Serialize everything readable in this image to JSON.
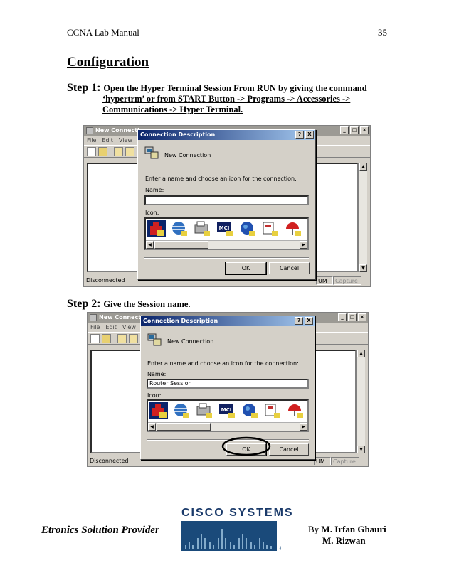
{
  "header": {
    "left": "CCNA Lab Manual",
    "right": "35"
  },
  "section_title": "Configuration",
  "steps": [
    {
      "label": "Step 1:",
      "text_line1": "Open the Hyper Terminal Session From RUN by giving the command",
      "text_line2": "‘hypertrm’ or from START Button -> Programs -> Accessories ->",
      "text_line3": "Communications -> Hyper Terminal."
    },
    {
      "label": "Step 2:",
      "text": "Give the Session name."
    }
  ],
  "screenshot1": {
    "window_title": "New Connecti",
    "menu": [
      "File",
      "Edit",
      "View"
    ],
    "status_left": "Disconnected",
    "status_num": "UM",
    "status_capture": "Capture",
    "dialog": {
      "title": "Connection Description",
      "help_btn": "?",
      "close_btn": "X",
      "heading": "New Connection",
      "instruction": "Enter a name and choose an icon for the connection:",
      "name_label": "Name:",
      "name_value": "",
      "icon_label": "Icon:",
      "mci_label": "MCI",
      "ok": "OK",
      "cancel": "Cancel"
    }
  },
  "screenshot2": {
    "window_title": "New Connecti",
    "menu": [
      "File",
      "Edit",
      "View"
    ],
    "status_left": "Disconnected",
    "status_num": "UM",
    "status_capture": "Capture",
    "dialog": {
      "title": "Connection Description",
      "help_btn": "?",
      "close_btn": "X",
      "heading": "New Connection",
      "instruction": "Enter a name and choose an icon for the connection:",
      "name_label": "Name:",
      "name_value": "Router Session",
      "icon_label": "Icon:",
      "mci_label": "MCI",
      "ok": "OK",
      "cancel": "Cancel"
    }
  },
  "footer": {
    "company": "Etronics Solution Provider",
    "logo_text": "CISCO SYSTEMS",
    "registered": "®",
    "author_prefix": "By",
    "author1": "M. Irfan Ghauri",
    "author2": "M. Rizwan"
  },
  "colors": {
    "title_bar_active": "#0a246a",
    "window_face": "#d4d0c8",
    "cisco_blue": "#1a3a6a"
  }
}
